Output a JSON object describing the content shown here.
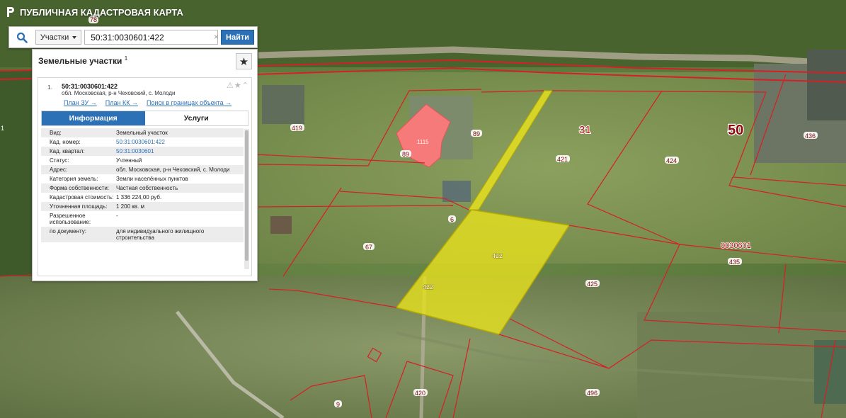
{
  "app": {
    "title": "ПУБЛИЧНАЯ КАДАСТРОВАЯ КАРТА"
  },
  "search": {
    "type_label": "Участки",
    "query": "50:31:0030601:422",
    "clear_icon": "×",
    "button_label": "Найти"
  },
  "results": {
    "title": "Земельные участки",
    "count": "1",
    "item": {
      "number": "1.",
      "cadastral_number": "50:31:0030601:422",
      "address": "обл. Московская, р-н Чеховский, с. Молоди",
      "links": [
        "План ЗУ →",
        "План КК →",
        "Поиск в границах объекта →"
      ]
    },
    "tabs": [
      "Информация",
      "Услуги"
    ],
    "properties": [
      {
        "key": "Вид:",
        "value": "Земельный участок"
      },
      {
        "key": "Кад. номер:",
        "value": "50:31:0030601:422"
      },
      {
        "key": "Кад. квартал:",
        "value": "50:31:0030601"
      },
      {
        "key": "Статус:",
        "value": "Учтенный"
      },
      {
        "key": "Адрес:",
        "value": "обл. Московская, р-н Чеховский, с. Молоди"
      },
      {
        "key": "Категория земель:",
        "value": "Земли населённых пунктов"
      },
      {
        "key": "Форма собственности:",
        "value": "Частная собственность"
      },
      {
        "key": "Кадастровая стоимость:",
        "value": "1 336 224,00 руб."
      },
      {
        "key": "Уточненная площадь:",
        "value": "1 200 кв. м"
      },
      {
        "key": "Разрешенное использование:",
        "value": "-"
      },
      {
        "key": "по документу:",
        "value": "для индивидуального жилищного строительства"
      }
    ]
  },
  "map": {
    "labels": {
      "l78": "78",
      "l419": "419",
      "l89a": "89",
      "l89b": "89",
      "l1115": "1115",
      "l421": "421",
      "l424": "424",
      "l436": "436",
      "l31": "31",
      "l50": "50",
      "l0030601": "0030601",
      "l435": "435",
      "l425": "425",
      "l67": "67",
      "l6": "6",
      "l422a": "422",
      "l422b": "422",
      "l420": "420",
      "l496": "496",
      "l9": "9",
      "l1": "1"
    },
    "colors": {
      "boundary": "#d61f26",
      "selected_fill": "#e4df20",
      "building_fill": "#f77a7a",
      "accent": "#2c70b5"
    }
  }
}
